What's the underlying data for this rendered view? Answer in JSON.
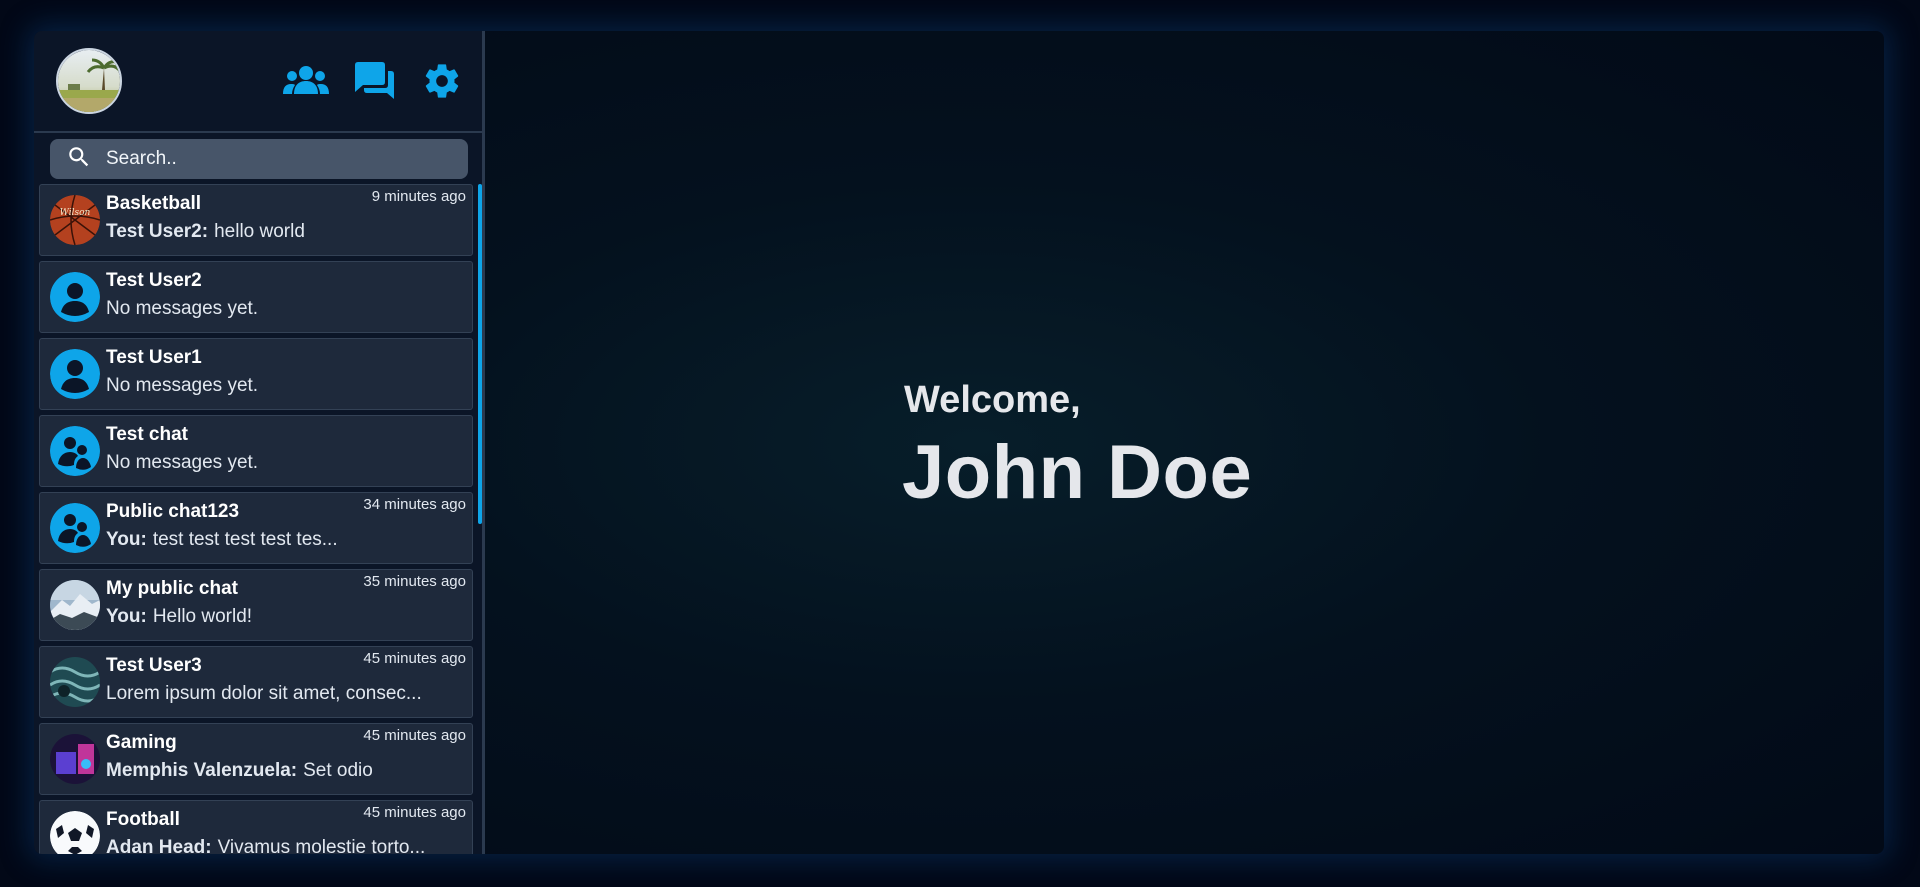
{
  "header": {
    "icons": [
      "users-icon",
      "chats-icon",
      "gear-icon"
    ],
    "accent": "#0ea5e9"
  },
  "search": {
    "placeholder": "Search.."
  },
  "chats": [
    {
      "name": "Basketball",
      "sender": "Test User2:",
      "message": "hello world",
      "time": "9 minutes ago",
      "avatar": "basketball-image"
    },
    {
      "name": "Test User2",
      "sender": "",
      "message": "No messages yet.",
      "time": "",
      "avatar": "user-icon"
    },
    {
      "name": "Test User1",
      "sender": "",
      "message": "No messages yet.",
      "time": "",
      "avatar": "user-icon"
    },
    {
      "name": "Test chat",
      "sender": "",
      "message": "No messages yet.",
      "time": "",
      "avatar": "group-icon"
    },
    {
      "name": "Public chat123",
      "sender": "You:",
      "message": "test test test test tes...",
      "time": "34 minutes ago",
      "avatar": "group-icon"
    },
    {
      "name": "My public chat",
      "sender": "You:",
      "message": "Hello world!",
      "time": "35 minutes ago",
      "avatar": "mountain-image"
    },
    {
      "name": "Test User3",
      "sender": "",
      "message": "Lorem ipsum dolor sit amet, consec...",
      "time": "45 minutes ago",
      "avatar": "ocean-image"
    },
    {
      "name": "Gaming",
      "sender": "Memphis Valenzuela:",
      "message": "Set odio",
      "time": "45 minutes ago",
      "avatar": "gaming-image"
    },
    {
      "name": "Football",
      "sender": "Adan Head:",
      "message": "Vivamus molestie torto...",
      "time": "45 minutes ago",
      "avatar": "football-image"
    }
  ],
  "main": {
    "welcome": "Welcome,",
    "user_name": "John Doe"
  }
}
